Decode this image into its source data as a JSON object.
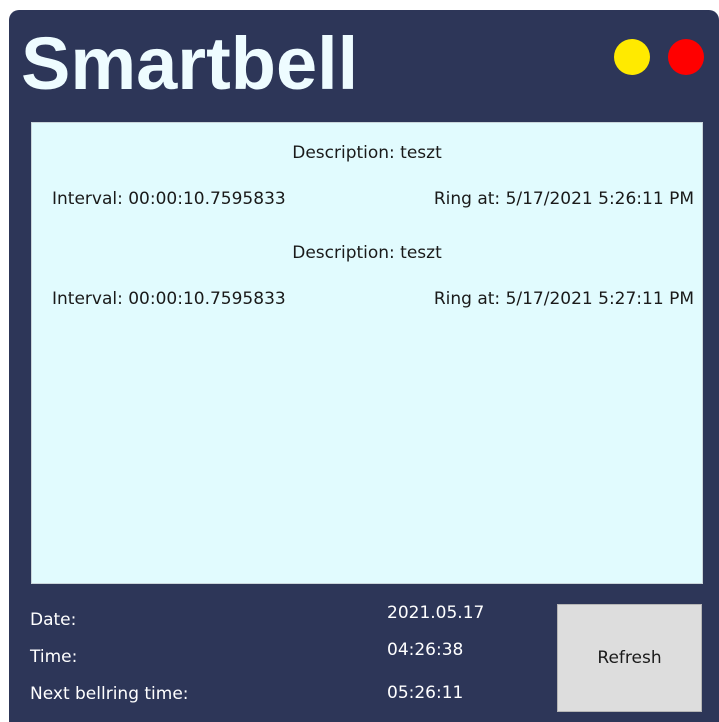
{
  "app": {
    "title": "Smartbell"
  },
  "window_controls": {
    "minimize_color": "#ffea00",
    "close_color": "#ff0000"
  },
  "schedule": [
    {
      "description": "Description: teszt",
      "interval": "Interval: 00:00:10.7595833",
      "ring_at": "Ring at: 5/17/2021 5:26:11 PM"
    },
    {
      "description": "Description: teszt",
      "interval": "Interval: 00:00:10.7595833",
      "ring_at": "Ring at: 5/17/2021 5:27:11 PM"
    }
  ],
  "status": {
    "date_label": "Date:",
    "date_value": "2021.05.17",
    "time_label": "Time:",
    "time_value": "04:26:38",
    "next_label": "Next bellring time:",
    "next_value": "05:26:11"
  },
  "actions": {
    "refresh_label": "Refresh"
  },
  "colors": {
    "window_background": "#2d3658",
    "title_text": "#eefcff",
    "list_background": "#e1fbfe",
    "button_background": "#dddddd"
  }
}
